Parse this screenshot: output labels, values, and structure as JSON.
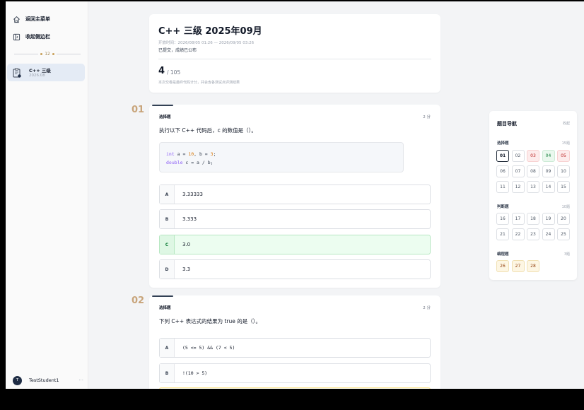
{
  "sidebar": {
    "back_label": "返回主菜单",
    "collapse_label": "收起侧边栏",
    "year_label": "12",
    "exam_item": {
      "title": "C++ 三级",
      "date": "2026.08"
    },
    "user": {
      "initial": "T",
      "name": "TestStudent1",
      "more": "···"
    }
  },
  "header": {
    "title": "C++ 三级 2025年09月",
    "time_range": "开放时间：2026/08/05 01:26 — 2026/09/05 03:26",
    "status": "已提交，成绩已公布",
    "score": "4",
    "total": "/ 105",
    "note": "本次交卷是最终代码计分，并会含各测试点评测结果"
  },
  "questions": [
    {
      "number": "01",
      "type": "选择题",
      "points": "2 分",
      "text": "执行以下 C++ 代码后，c 的数值是（）。",
      "code": {
        "line1": {
          "kw": "int",
          "a": " a = ",
          "n1": "10",
          "b": ", b = ",
          "n2": "3",
          "end": ";"
        },
        "line2": {
          "kw": "double",
          "rest": " c = a / b;"
        }
      },
      "options": [
        {
          "letter": "A",
          "text": "3.33333"
        },
        {
          "letter": "B",
          "text": "3.333"
        },
        {
          "letter": "C",
          "text": "3.0"
        },
        {
          "letter": "D",
          "text": "3.3"
        }
      ]
    },
    {
      "number": "02",
      "type": "选择题",
      "points": "2 分",
      "text": "下列 C++ 表达式的结果为 true 的是（）。",
      "options": [
        {
          "letter": "A",
          "text": "(5 <= 5) && (7 < 5)"
        },
        {
          "letter": "B",
          "text": "!(10 > 5)"
        }
      ]
    }
  ],
  "nav": {
    "title": "题目导航",
    "collapse": "收起",
    "sections": [
      {
        "name": "选择题",
        "count": "15题",
        "items": [
          "01",
          "02",
          "03",
          "04",
          "05",
          "06",
          "07",
          "08",
          "09",
          "10",
          "11",
          "12",
          "13",
          "14",
          "15"
        ]
      },
      {
        "name": "判断题",
        "count": "10题",
        "items": [
          "16",
          "17",
          "18",
          "19",
          "20",
          "21",
          "22",
          "23",
          "24",
          "25"
        ]
      },
      {
        "name": "编程题",
        "count": "3题",
        "items": [
          "26",
          "27",
          "28"
        ]
      }
    ]
  },
  "colors": {
    "accent": "#334155",
    "correct_bg": "#ecfdf0",
    "wrong_bg": "#fdecec",
    "number_gold": "#c8a47a"
  }
}
